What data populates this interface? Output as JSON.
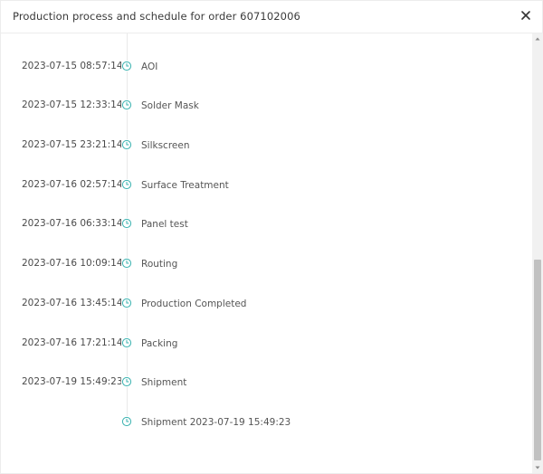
{
  "dialog": {
    "title": "Production process and schedule for order 607102006",
    "close_icon": "close-icon"
  },
  "timeline": {
    "icon": "clock-icon",
    "accent_color": "#3bb3b0",
    "items": [
      {
        "time": "2023-07-15 08:57:14",
        "label": "AOI"
      },
      {
        "time": "2023-07-15 12:33:14",
        "label": "Solder Mask"
      },
      {
        "time": "2023-07-15 23:21:14",
        "label": "Silkscreen"
      },
      {
        "time": "2023-07-16 02:57:14",
        "label": "Surface Treatment"
      },
      {
        "time": "2023-07-16 06:33:14",
        "label": "Panel test"
      },
      {
        "time": "2023-07-16 10:09:14",
        "label": "Routing"
      },
      {
        "time": "2023-07-16 13:45:14",
        "label": "Production Completed"
      },
      {
        "time": "2023-07-16 17:21:14",
        "label": "Packing"
      },
      {
        "time": "2023-07-19 15:49:23",
        "label": "Shipment"
      },
      {
        "time": "",
        "label": "Shipment 2023-07-19 15:49:23"
      }
    ]
  }
}
